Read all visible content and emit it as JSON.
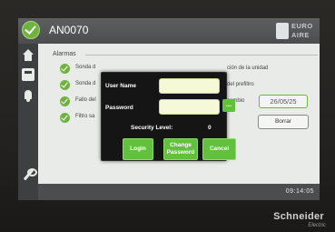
{
  "header": {
    "title": "AN0070",
    "logo_line1": "EURO",
    "logo_line2": "AIRE"
  },
  "sidebar": {
    "icons": [
      "home-icon",
      "panel-icon",
      "bell-icon",
      "wrench-icon"
    ]
  },
  "alarms": {
    "title": "Alarmas",
    "rows": [
      {
        "text": "Sonda d"
      },
      {
        "text": "Sonda d"
      },
      {
        "text": "Fallo del"
      },
      {
        "text": "Filtro sa"
      }
    ],
    "right_texts": [
      "ción de la unidad",
      "del prefiltro",
      "cambio"
    ],
    "date_value": "26/05/25",
    "borrar_label": "Borrar"
  },
  "status": {
    "time": "09:14:05"
  },
  "login": {
    "username_label": "User Name",
    "password_label": "Password",
    "dots_label": "...",
    "username_value": "",
    "password_value": "",
    "security_label": "Security Level:",
    "security_value": "0",
    "login_label": "Login",
    "change_line1": "Change",
    "change_line2": "Password",
    "cancel_label": "Cancel"
  },
  "device": {
    "brand": "Schneider",
    "brand_sub": "Electric"
  },
  "colors": {
    "accent_green": "#61c13a",
    "field_bg": "#f6f9d8",
    "topbar": "#4b4d4f"
  }
}
